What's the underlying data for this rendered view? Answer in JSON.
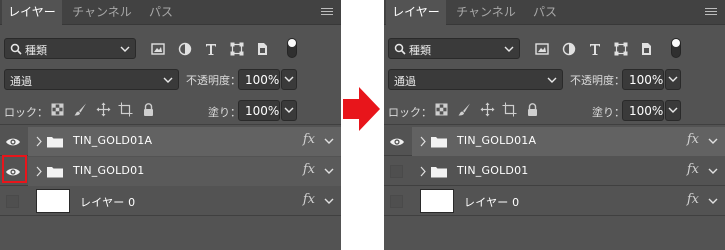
{
  "panels": [
    {
      "tabs": [
        "レイヤー",
        "チャンネル",
        "パス"
      ],
      "filter": {
        "label": "種類"
      },
      "blend_mode": "通過",
      "opacity": {
        "label": "不透明度：",
        "value": "100%"
      },
      "lock": {
        "label": "ロック："
      },
      "fill": {
        "label": "塗り：",
        "value": "100%"
      },
      "layers": [
        {
          "name": "TIN_GOLD01A",
          "fx": "fx"
        },
        {
          "name": "TIN_GOLD01",
          "fx": "fx"
        },
        {
          "name": "レイヤー 0",
          "fx": "fx"
        }
      ]
    },
    {
      "tabs": [
        "レイヤー",
        "チャンネル",
        "パス"
      ],
      "filter": {
        "label": "種類"
      },
      "blend_mode": "通過",
      "opacity": {
        "label": "不透明度：",
        "value": "100%"
      },
      "lock": {
        "label": "ロック："
      },
      "fill": {
        "label": "塗り：",
        "value": "100%"
      },
      "layers": [
        {
          "name": "TIN_GOLD01A",
          "fx": "fx"
        },
        {
          "name": "TIN_GOLD01",
          "fx": "fx"
        },
        {
          "name": "レイヤー 0",
          "fx": "fx"
        }
      ]
    }
  ],
  "colors": {
    "highlight": "#e8151b",
    "arrow": "#e8151b",
    "panel_bg": "#535353"
  }
}
